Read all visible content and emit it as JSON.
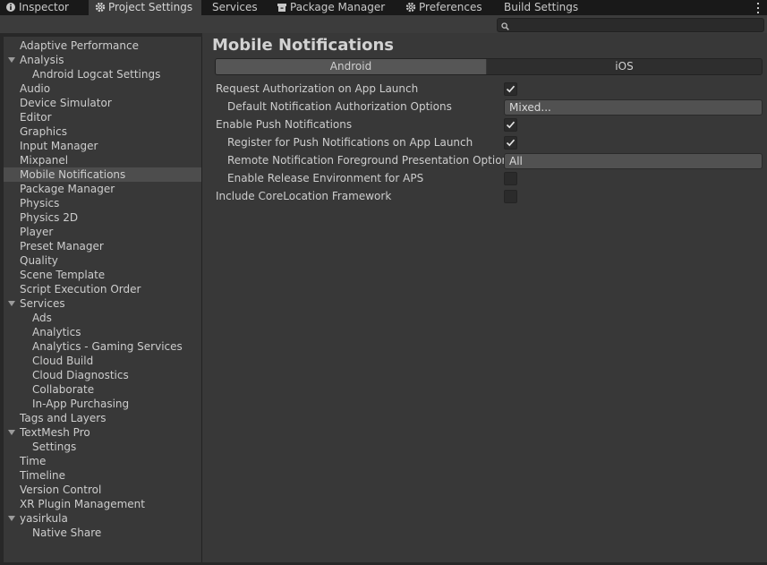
{
  "tabs": [
    {
      "label": "Inspector",
      "icon": "info-icon",
      "active": false
    },
    {
      "label": "Project Settings",
      "icon": "gear-icon",
      "active": true
    },
    {
      "label": "Services",
      "icon": "",
      "active": false
    },
    {
      "label": "Package Manager",
      "icon": "package-icon",
      "active": false
    },
    {
      "label": "Preferences",
      "icon": "gear-icon",
      "active": false
    },
    {
      "label": "Build Settings",
      "icon": "",
      "active": false
    }
  ],
  "search": {
    "placeholder": "",
    "value": ""
  },
  "sidebar": {
    "items": [
      {
        "label": "Adaptive Performance",
        "level": 0
      },
      {
        "label": "Analysis",
        "level": 0,
        "expanded": true
      },
      {
        "label": "Android Logcat Settings",
        "level": 1
      },
      {
        "label": "Audio",
        "level": 0
      },
      {
        "label": "Device Simulator",
        "level": 0
      },
      {
        "label": "Editor",
        "level": 0
      },
      {
        "label": "Graphics",
        "level": 0
      },
      {
        "label": "Input Manager",
        "level": 0
      },
      {
        "label": "Mixpanel",
        "level": 0
      },
      {
        "label": "Mobile Notifications",
        "level": 0,
        "selected": true
      },
      {
        "label": "Package Manager",
        "level": 0
      },
      {
        "label": "Physics",
        "level": 0
      },
      {
        "label": "Physics 2D",
        "level": 0
      },
      {
        "label": "Player",
        "level": 0
      },
      {
        "label": "Preset Manager",
        "level": 0
      },
      {
        "label": "Quality",
        "level": 0
      },
      {
        "label": "Scene Template",
        "level": 0
      },
      {
        "label": "Script Execution Order",
        "level": 0
      },
      {
        "label": "Services",
        "level": 0,
        "expanded": true
      },
      {
        "label": "Ads",
        "level": 1
      },
      {
        "label": "Analytics",
        "level": 1
      },
      {
        "label": "Analytics - Gaming Services",
        "level": 1
      },
      {
        "label": "Cloud Build",
        "level": 1
      },
      {
        "label": "Cloud Diagnostics",
        "level": 1
      },
      {
        "label": "Collaborate",
        "level": 1
      },
      {
        "label": "In-App Purchasing",
        "level": 1
      },
      {
        "label": "Tags and Layers",
        "level": 0
      },
      {
        "label": "TextMesh Pro",
        "level": 0,
        "expanded": true
      },
      {
        "label": "Settings",
        "level": 1
      },
      {
        "label": "Time",
        "level": 0
      },
      {
        "label": "Timeline",
        "level": 0
      },
      {
        "label": "Version Control",
        "level": 0
      },
      {
        "label": "XR Plugin Management",
        "level": 0
      },
      {
        "label": "yasirkula",
        "level": 0,
        "expanded": true
      },
      {
        "label": "Native Share",
        "level": 1
      }
    ]
  },
  "main": {
    "title": "Mobile Notifications",
    "platform_tabs": [
      {
        "label": "Android",
        "active": true
      },
      {
        "label": "iOS",
        "active": false
      }
    ],
    "properties": [
      {
        "label": "Request Authorization on App Launch",
        "level": 0,
        "type": "checkbox",
        "checked": true
      },
      {
        "label": "Default Notification Authorization Options",
        "level": 1,
        "type": "dropdown",
        "value": "Mixed..."
      },
      {
        "label": "Enable Push Notifications",
        "level": 0,
        "type": "checkbox",
        "checked": true
      },
      {
        "label": "Register for Push Notifications on App Launch",
        "level": 1,
        "type": "checkbox",
        "checked": true
      },
      {
        "label": "Remote Notification Foreground Presentation Options",
        "level": 1,
        "type": "dropdown",
        "value": "All"
      },
      {
        "label": "Enable Release Environment for APS",
        "level": 1,
        "type": "checkbox",
        "checked": false
      },
      {
        "label": "Include CoreLocation Framework",
        "level": 0,
        "type": "checkbox",
        "checked": false
      }
    ]
  },
  "colors": {
    "background": "#282828",
    "panel": "#383838",
    "selection": "#4d4d4d",
    "text": "#c4c4c4"
  }
}
